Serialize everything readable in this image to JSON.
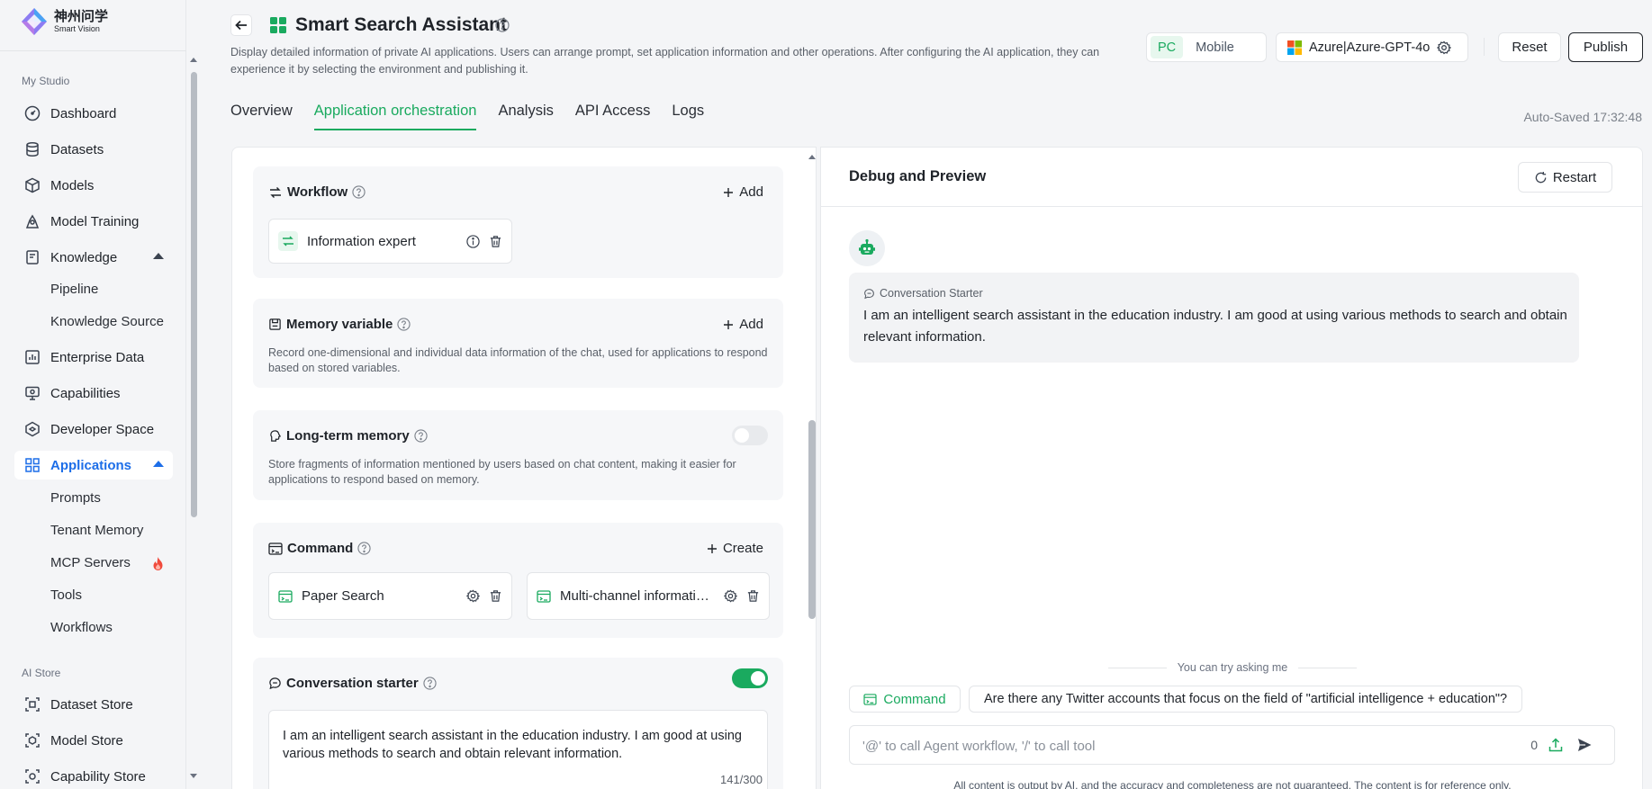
{
  "brand": {
    "name_cn": "神州问学",
    "name_en": "Smart Vision"
  },
  "sidebar": {
    "section_my_studio": "My Studio",
    "dashboard": "Dashboard",
    "datasets": "Datasets",
    "models": "Models",
    "model_training": "Model Training",
    "knowledge": "Knowledge",
    "pipeline": "Pipeline",
    "knowledge_source": "Knowledge Source",
    "enterprise_data": "Enterprise Data",
    "capabilities": "Capabilities",
    "developer_space": "Developer Space",
    "applications": "Applications",
    "prompts": "Prompts",
    "tenant_memory": "Tenant Memory",
    "mcp_servers": "MCP Servers",
    "tools": "Tools",
    "workflows": "Workflows",
    "section_ai_store": "AI Store",
    "dataset_store": "Dataset Store",
    "model_store": "Model Store",
    "capability_store": "Capability Store"
  },
  "header": {
    "title": "Smart Search Assistant",
    "description": "Display detailed information of private AI applications. Users can arrange prompt, set application information and other operations. After configuring the AI application, they can experience it by selecting the environment and publishing it.",
    "device_pc": "PC",
    "device_mobile": "Mobile",
    "model": "Azure|Azure-GPT-4o",
    "reset": "Reset",
    "publish": "Publish",
    "autosaved": "Auto-Saved 17:32:48"
  },
  "tabs": [
    "Overview",
    "Application orchestration",
    "Analysis",
    "API Access",
    "Logs"
  ],
  "orchestration": {
    "workflow": {
      "title": "Workflow",
      "action": "Add",
      "items": [
        "Information expert"
      ]
    },
    "memory_variable": {
      "title": "Memory variable",
      "action": "Add",
      "desc": "Record one-dimensional and individual data information of the chat, used for applications to respond based on stored variables."
    },
    "long_term_memory": {
      "title": "Long-term memory",
      "enabled": false,
      "desc": "Store fragments of information mentioned by users based on chat content, making it easier for applications to respond based on memory."
    },
    "command": {
      "title": "Command",
      "action": "Create",
      "items": [
        "Paper Search",
        "Multi-channel information retrieval"
      ]
    },
    "conversation_starter": {
      "title": "Conversation starter",
      "enabled": true,
      "text": "I am an intelligent search assistant in the education industry. I am good at using various methods to search and obtain relevant information.",
      "count": "141/300"
    }
  },
  "preview": {
    "title": "Debug and Preview",
    "restart": "Restart",
    "starter_label": "Conversation Starter",
    "starter_text": "I am an intelligent search assistant in the education industry. I am good at using various methods to search and obtain relevant information.",
    "try_label": "You can try asking me",
    "command_chip": "Command",
    "suggestion": "Are there any Twitter accounts that focus on the field of \"artificial intelligence + education\"?",
    "input_placeholder": "'@' to call Agent workflow, '/' to call tool",
    "char_count": "0",
    "disclaimer": "All content is output by AI, and the accuracy and completeness are not guaranteed. The content is for reference only."
  },
  "colors": {
    "accent_green": "#1aaa5f",
    "accent_blue": "#1d6ee8",
    "hot": "#f04a3c"
  }
}
